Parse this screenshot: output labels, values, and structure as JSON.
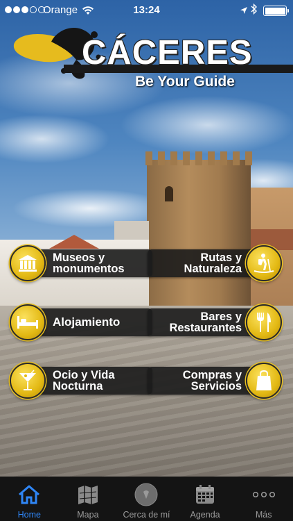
{
  "status_bar": {
    "carrier": "Orange",
    "time": "13:24",
    "signal_bars": 3,
    "signal_max": 5,
    "battery_level": 1.0
  },
  "header": {
    "title": "CÁCERES",
    "subtitle": "Be Your Guide"
  },
  "colors": {
    "accent_gold": "#e3b914",
    "tab_active": "#2f86f6",
    "tab_inactive": "#9a9a9a",
    "button_bg": "#1c1c1c"
  },
  "menu": {
    "museos": {
      "line1": "Museos y",
      "line2": "monumentos",
      "icon": "museum-icon"
    },
    "rutas": {
      "line1": "Rutas y",
      "line2": "Naturaleza",
      "icon": "hiker-icon"
    },
    "alojamiento": {
      "line1": "Alojamiento",
      "icon": "bed-icon"
    },
    "bares": {
      "line1": "Bares y",
      "line2": "Restaurantes",
      "icon": "fork-knife-icon"
    },
    "ocio": {
      "line1": "Ocio y Vida",
      "line2": "Nocturna",
      "icon": "cocktail-icon"
    },
    "compras": {
      "line1": "Compras y",
      "line2": "Servicios",
      "icon": "shopping-bag-icon"
    }
  },
  "tabs": [
    {
      "label": "Home",
      "icon": "home-icon",
      "active": true
    },
    {
      "label": "Mapa",
      "icon": "map-icon",
      "active": false
    },
    {
      "label": "Cerca de mí",
      "icon": "nearby-icon",
      "active": false
    },
    {
      "label": "Agenda",
      "icon": "calendar-icon",
      "active": false
    },
    {
      "label": "Más",
      "icon": "more-icon",
      "active": false
    }
  ]
}
